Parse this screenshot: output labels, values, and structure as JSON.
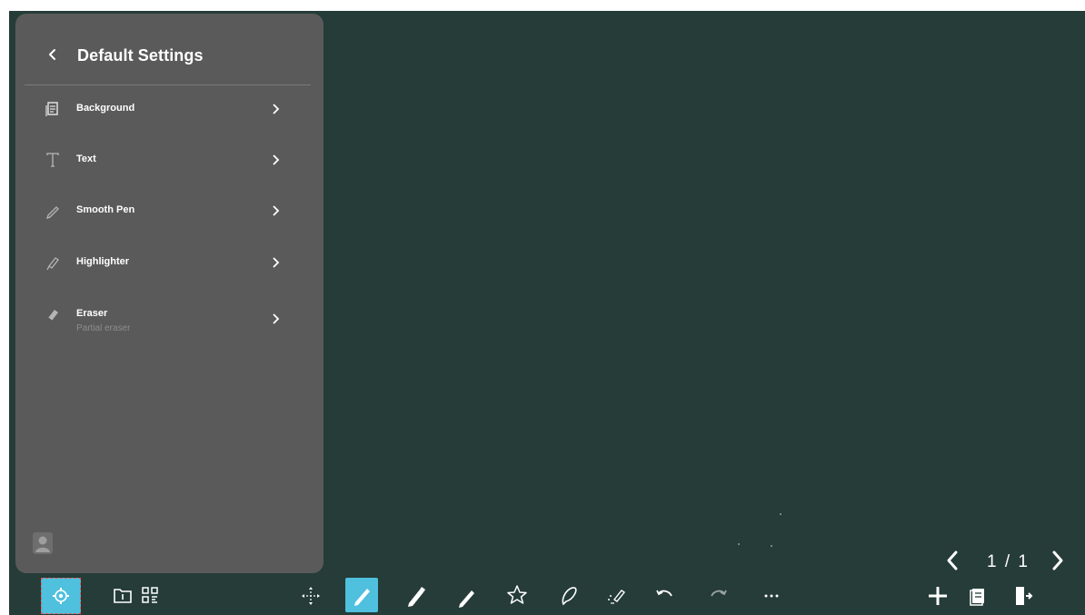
{
  "panel": {
    "title": "Default Settings",
    "items": [
      {
        "label": "Background",
        "icon": "background-icon"
      },
      {
        "label": "Text",
        "icon": "text-icon"
      },
      {
        "label": "Smooth Pen",
        "icon": "smooth-pen-icon"
      },
      {
        "label": "Highlighter",
        "icon": "highlighter-icon"
      },
      {
        "label": "Eraser",
        "icon": "eraser-icon",
        "sub": "Partial eraser"
      }
    ]
  },
  "pager": {
    "label": "1 / 1"
  },
  "toolbar": {
    "icons": [
      "settings-icon",
      "folder-icon",
      "qr-code-icon",
      "move-icon",
      "pen-icon",
      "brush-icon",
      "pencil-icon",
      "star-icon",
      "lasso-icon",
      "magic-pen-icon",
      "undo-icon",
      "redo-icon",
      "more-icon",
      "add-page-icon",
      "pages-icon",
      "exit-icon"
    ]
  },
  "colors": {
    "canvas": "#253c38",
    "panel": "#5a5a5a",
    "accent": "#4fc0de"
  }
}
